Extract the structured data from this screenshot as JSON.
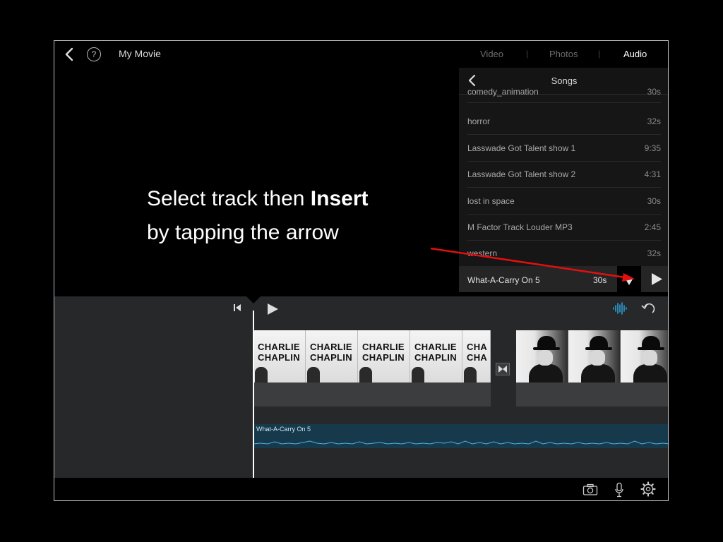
{
  "header": {
    "title": "My Movie",
    "help_glyph": "?",
    "tabs": [
      {
        "label": "Video",
        "active": false
      },
      {
        "label": "Photos",
        "active": false
      },
      {
        "label": "Audio",
        "active": true
      }
    ],
    "separator": "|"
  },
  "songs_panel": {
    "title": "Songs",
    "items": [
      {
        "name": "comedy_animation",
        "duration": "30s"
      },
      {
        "name": "horror",
        "duration": "32s"
      },
      {
        "name": "Lasswade Got Talent show 1",
        "duration": "9:35"
      },
      {
        "name": "Lasswade Got Talent show 2",
        "duration": "4:31"
      },
      {
        "name": "lost in space",
        "duration": "30s"
      },
      {
        "name": "M Factor Track Louder MP3",
        "duration": "2:45"
      },
      {
        "name": "western",
        "duration": "32s"
      }
    ],
    "selected": {
      "name": "What-A-Carry On 5",
      "duration": "30s"
    }
  },
  "instruction": {
    "line1_prefix": "Select track then ",
    "line1_bold": "Insert",
    "line2": "by tapping the arrow"
  },
  "timeline": {
    "clip1_frames": [
      {
        "line1": "CHARLIE",
        "line2": "CHAPLIN"
      },
      {
        "line1": "CHARLIE",
        "line2": "CHAPLIN"
      },
      {
        "line1": "CHARLIE",
        "line2": "CHAPLIN"
      },
      {
        "line1": "CHARLIE",
        "line2": "CHAPLIN"
      },
      {
        "line1": "CHA",
        "line2": "CHA"
      }
    ],
    "audio_clip_label": "What-A-Carry On 5"
  },
  "colors": {
    "accent_blue": "#2d9fd9",
    "arrow_red": "#e01010",
    "audio_track": "#163a4c"
  },
  "icons": {
    "back": "chevron-left-icon",
    "help": "question-circle-icon",
    "insert": "arrow-down-icon",
    "preview": "play-icon",
    "skip_start": "skip-to-start-icon",
    "play": "play-icon",
    "waveform": "waveform-icon",
    "undo": "undo-icon",
    "camera": "camera-icon",
    "mic": "microphone-icon",
    "settings": "gear-icon"
  }
}
